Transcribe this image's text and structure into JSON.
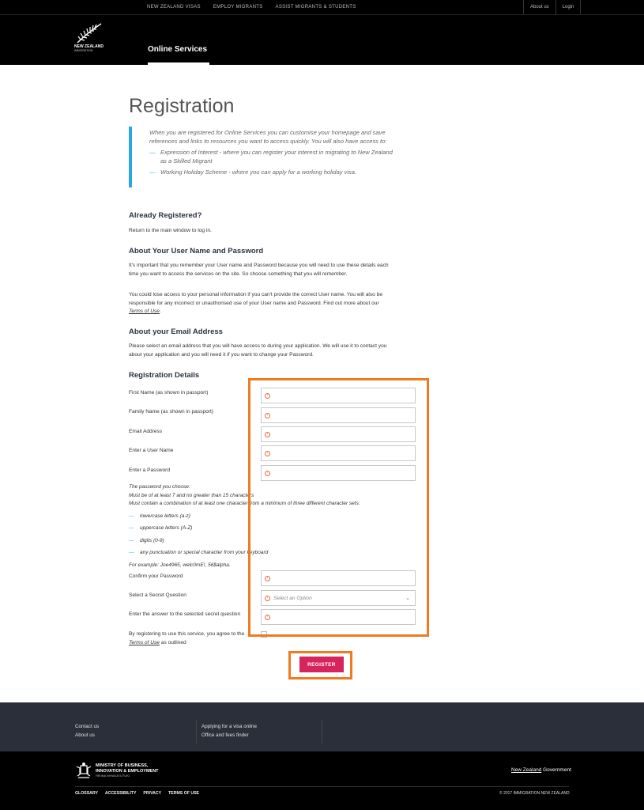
{
  "topnav": [
    "NEW ZEALAND VISAS",
    "EMPLOY MIGRANTS",
    "ASSIST MIGRANTS & STUDENTS"
  ],
  "topright": [
    "About us",
    "Login"
  ],
  "logo": {
    "line1": "NEW ZEALAND",
    "line2": "IMMIGRATION"
  },
  "services_tab": "Online Services",
  "page_title": "Registration",
  "intro": {
    "text": "When you are registered for Online Services you can customise your homepage and save references and links to resources you want to access quickly. You will also have access to:",
    "items": [
      "Expression of Interest - where you can register your interest in migrating to New Zealand as a Skilled Migrant",
      "Working Holiday Scheme - where you can apply for a working holiday visa."
    ]
  },
  "already": {
    "heading": "Already Registered?",
    "text": "Return to the main window to log in."
  },
  "username": {
    "heading": "About Your User Name and Password",
    "p1": "It's important that you remember your User name and Password because you will need to use these details each time you want to access the services on the site. So choose something that you will remember.",
    "p2_text": "You could lose access to your personal information if you can't provide the correct User name. You will also be responsible for any incorrect or unauthorised use of your User name and Password. Find out more about our ",
    "p2_link": "Terms of Use",
    "p2_end": "."
  },
  "email": {
    "heading": "About your Email Address",
    "text": "Please select an email address that you will have access to during your application. We will use it to contact you about your application and you will need it if you want to change your Password."
  },
  "registration": {
    "heading": "Registration Details",
    "first_name": "First Name (as shown in passport)",
    "family_name": "Family Name (as shown in passport)",
    "email": "Email Address",
    "user_name": "Enter a User Name",
    "password": "Enter a Password",
    "confirm": "Confirm your Password",
    "secret_q": "Select a Secret Question",
    "secret_q_placeholder": "Select an Option",
    "secret_a": "Enter the answer to the selected secret question"
  },
  "password_rules": {
    "line1": "The password you choose:",
    "line2": "Must be of at least 7 and no greater than 15 characters",
    "line3": "Must contain a combination of at least one character from a minimum of three different character sets:",
    "items": [
      "lowercase letters (a-z)",
      "uppercase letters (A-Z)",
      "digits (0-9)",
      "any punctuation or special character from your keyboard"
    ],
    "example": "For example: Joe4965, welc0mE!, 56$alpha."
  },
  "terms": {
    "text": "By registering to use this service, you agree to the ",
    "link": "Terms of Use",
    "end": " as outlined"
  },
  "register_button": "REGISTER",
  "footer": {
    "col1": [
      "Contact us",
      "About us"
    ],
    "col2": [
      "Applying for a visa online",
      "Office and fees finder"
    ],
    "mbie": [
      "MINISTRY OF BUSINESS,",
      "INNOVATION & EMPLOYMENT"
    ],
    "mbie_sub": "HĪKINA WHAKATUTUKI",
    "nzgov_a": "New Zealand",
    "nzgov_b": " Government",
    "links": [
      "GLOSSARY",
      "ACCESSIBILITY",
      "PRIVACY",
      "TERMS OF USE"
    ],
    "copyright": "© 2017 IMMIGRATION NEW ZEALAND"
  },
  "colors": {
    "accent_blue": "#2aa6e0",
    "register_pink": "#d6255d",
    "highlight_orange": "#f07a1f",
    "warning": "#e26a4a"
  }
}
